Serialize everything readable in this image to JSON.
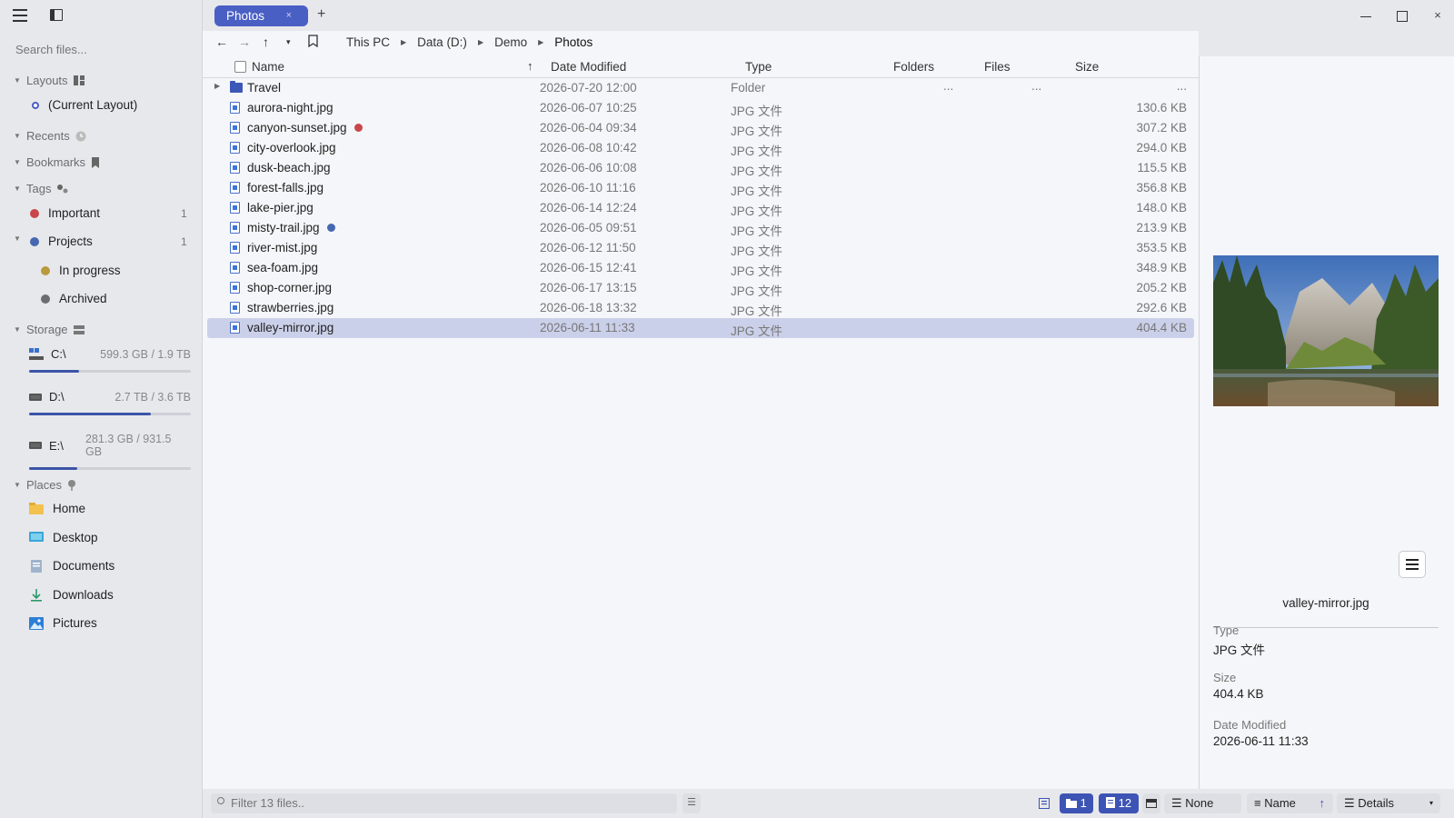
{
  "sidebar": {
    "search_placeholder": "Search files...",
    "layouts": {
      "label": "Layouts",
      "items": [
        "(Current Layout)"
      ]
    },
    "recents": {
      "label": "Recents"
    },
    "bookmarks": {
      "label": "Bookmarks"
    },
    "tags": {
      "label": "Tags",
      "items": [
        {
          "label": "Important",
          "count": "1",
          "color": "#c8464b"
        },
        {
          "label": "Projects",
          "count": "1",
          "color": "#4568b0"
        },
        {
          "label": "In progress",
          "color": "#b99a3e"
        },
        {
          "label": "Archived",
          "color": "#6c6d73"
        }
      ]
    },
    "storage": {
      "label": "Storage",
      "drives": [
        {
          "name": "C:\\",
          "size": "599.3 GB / 1.9 TB",
          "used_fraction": 0.31
        },
        {
          "name": "D:\\",
          "size": "2.7 TB / 3.6 TB",
          "used_fraction": 0.75
        },
        {
          "name": "E:\\",
          "size": "281.3 GB / 931.5 GB",
          "used_fraction": 0.3
        }
      ]
    },
    "places": {
      "label": "Places",
      "items": [
        "Home",
        "Desktop",
        "Documents",
        "Downloads",
        "Pictures"
      ]
    }
  },
  "tabs": {
    "active_label": "Photos",
    "close_glyph": "×",
    "add_glyph": "+"
  },
  "window": {
    "close_glyph": "×"
  },
  "nav": {
    "back": "←",
    "forward": "→",
    "up": "↑",
    "history": "▾",
    "breadcrumb": [
      "This PC",
      "Data (D:)",
      "Demo",
      "Photos"
    ]
  },
  "columns": {
    "name": "Name",
    "date": "Date Modified",
    "type": "Type",
    "folders": "Folders",
    "files": "Files",
    "size": "Size",
    "sort_glyph": "↑"
  },
  "rows": [
    {
      "name": "Travel",
      "date": "2026-07-20 12:00",
      "type": "Folder",
      "size": "",
      "kind": "folder"
    },
    {
      "name": "aurora-night.jpg",
      "date": "2026-06-07 10:25",
      "type": "JPG 文件",
      "size": "130.6 KB"
    },
    {
      "name": "canyon-sunset.jpg",
      "date": "2026-06-04 09:34",
      "type": "JPG 文件",
      "size": "307.2 KB",
      "tag_color": "#c8464b"
    },
    {
      "name": "city-overlook.jpg",
      "date": "2026-06-08 10:42",
      "type": "JPG 文件",
      "size": "294.0 KB"
    },
    {
      "name": "dusk-beach.jpg",
      "date": "2026-06-06 10:08",
      "type": "JPG 文件",
      "size": "115.5 KB"
    },
    {
      "name": "forest-falls.jpg",
      "date": "2026-06-10 11:16",
      "type": "JPG 文件",
      "size": "356.8 KB"
    },
    {
      "name": "lake-pier.jpg",
      "date": "2026-06-14 12:24",
      "type": "JPG 文件",
      "size": "148.0 KB"
    },
    {
      "name": "misty-trail.jpg",
      "date": "2026-06-05 09:51",
      "type": "JPG 文件",
      "size": "213.9 KB",
      "tag_color": "#4568b0"
    },
    {
      "name": "river-mist.jpg",
      "date": "2026-06-12 11:50",
      "type": "JPG 文件",
      "size": "353.5 KB"
    },
    {
      "name": "sea-foam.jpg",
      "date": "2026-06-15 12:41",
      "type": "JPG 文件",
      "size": "348.9 KB"
    },
    {
      "name": "shop-corner.jpg",
      "date": "2026-06-17 13:15",
      "type": "JPG 文件",
      "size": "205.2 KB"
    },
    {
      "name": "strawberries.jpg",
      "date": "2026-06-18 13:32",
      "type": "JPG 文件",
      "size": "292.6 KB"
    },
    {
      "name": "valley-mirror.jpg",
      "date": "2026-06-11 11:33",
      "type": "JPG 文件",
      "size": "404.4 KB",
      "selected": true
    }
  ],
  "folder_placeholder": "...",
  "preview": {
    "name": "valley-mirror.jpg",
    "type_label": "Type",
    "type_value": "JPG 文件",
    "size_label": "Size",
    "size_value": "404.4 KB",
    "date_label": "Date Modified",
    "date_value": "2026-06-11 11:33"
  },
  "status": {
    "filter_placeholder": "Filter 13 files..",
    "folder_count": "1",
    "file_count": "12",
    "group_label": "None",
    "sort_label": "Name",
    "sort_glyph": "↑",
    "view_label": "Details",
    "view_caret": "▾"
  },
  "colors": {
    "accent": "#4a5fc4",
    "selection": "#cbd0ea",
    "sidebar_bg": "#e7e8ec",
    "content_bg": "#f5f6f9"
  }
}
